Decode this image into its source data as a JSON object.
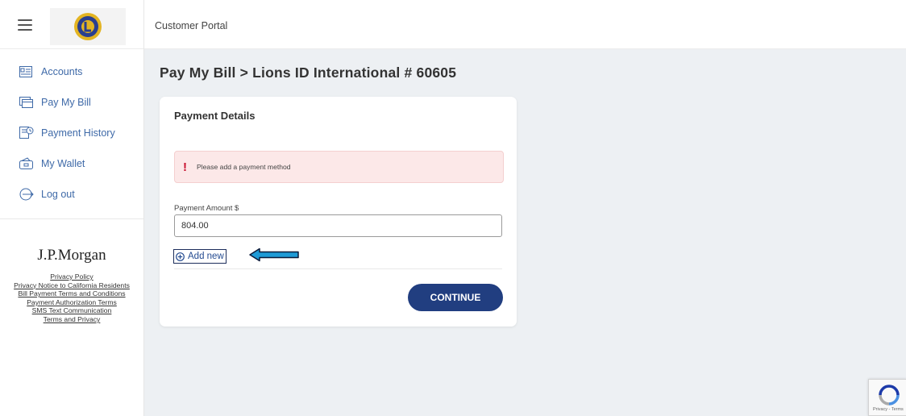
{
  "app": {
    "portal_title": "Customer Portal",
    "logo_name": "Lions Clubs International logo"
  },
  "sidebar": {
    "items": [
      {
        "label": "Accounts",
        "icon": "accounts-icon"
      },
      {
        "label": "Pay My Bill",
        "icon": "pay-bill-icon"
      },
      {
        "label": "Payment History",
        "icon": "payment-history-icon"
      },
      {
        "label": "My Wallet",
        "icon": "wallet-icon"
      },
      {
        "label": "Log out",
        "icon": "logout-icon"
      }
    ],
    "brand": "J.P.Morgan",
    "footer_links": [
      "Privacy Policy",
      "Privacy Notice to California Residents",
      "Bill Payment Terms and Conditions",
      "Payment Authorization Terms",
      "SMS Text Communication",
      "Terms and Privacy"
    ]
  },
  "page": {
    "breadcrumb_root": "Pay My Bill",
    "breadcrumb_sep": ">",
    "breadcrumb_current": "Lions ID International # 60605"
  },
  "payment": {
    "card_title": "Payment Details",
    "alert_text": "Please add a payment method",
    "amount_label": "Payment Amount $",
    "amount_value": "804.00",
    "add_new_label": "Add new",
    "continue_label": "CONTINUE"
  },
  "recaptcha": {
    "text": "Privacy - Terms"
  },
  "colors": {
    "accent": "#213e80",
    "link": "#3f6aa8",
    "alert_bg": "#fce8e8",
    "alert_icon": "#c8102e",
    "annotation_arrow": "#1e9ad6"
  }
}
